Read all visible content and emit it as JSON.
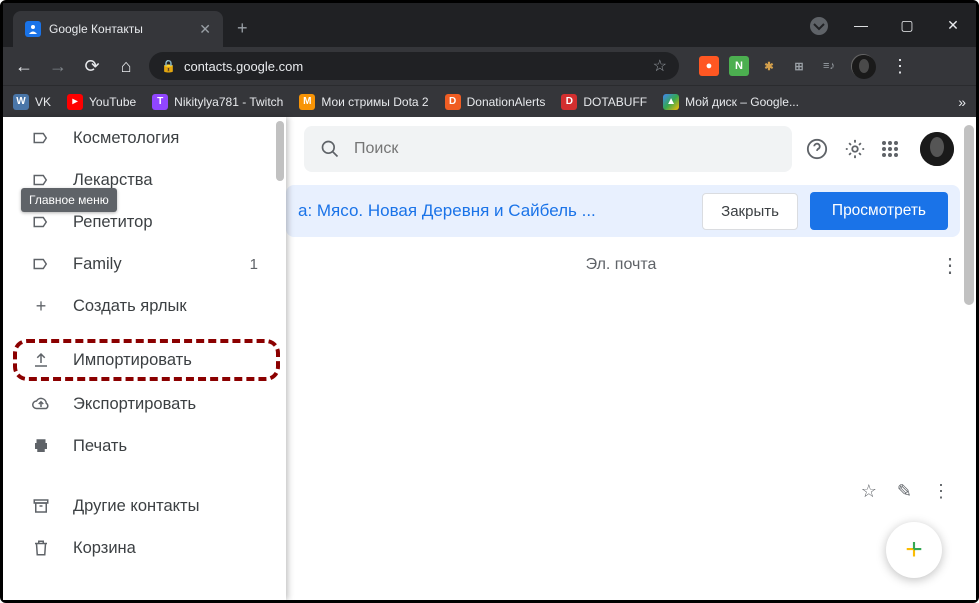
{
  "window": {
    "tab_title": "Google Контакты"
  },
  "address": {
    "url": "contacts.google.com"
  },
  "bookmarks": [
    {
      "icon_bg": "#4a76a8",
      "icon_text": "W",
      "label": "VK"
    },
    {
      "icon_bg": "#ff0000",
      "icon_text": "▸",
      "label": "YouTube"
    },
    {
      "icon_bg": "#9146ff",
      "icon_text": "T",
      "label": "Nikitylya781 - Twitch"
    },
    {
      "icon_bg": "#f89406",
      "icon_text": "M",
      "label": "Мои стримы Dota 2"
    },
    {
      "icon_bg": "#f05d23",
      "icon_text": "D",
      "label": "DonationAlerts"
    },
    {
      "icon_bg": "#d32f2f",
      "icon_text": "D",
      "label": "DOTABUFF"
    },
    {
      "icon_bg": "#0f9d58",
      "icon_text": "▲",
      "label": "Мой диск – Google..."
    }
  ],
  "tooltip": "Главное меню",
  "sidebar": {
    "labels": [
      {
        "label": "Косметология"
      },
      {
        "label": "Лекарства"
      },
      {
        "label": "Репетитор"
      },
      {
        "label": "Family",
        "count": "1"
      }
    ],
    "create": "Создать ярлык",
    "import": "Импортировать",
    "export": "Экспортировать",
    "print": "Печать",
    "other": "Другие контакты",
    "trash": "Корзина"
  },
  "search": {
    "placeholder": "Поиск"
  },
  "banner": {
    "text": "а: Мясо. Новая Деревня и Сайбель ...",
    "close": "Закрыть",
    "view": "Просмотреть"
  },
  "columns": {
    "email": "Эл. почта"
  }
}
